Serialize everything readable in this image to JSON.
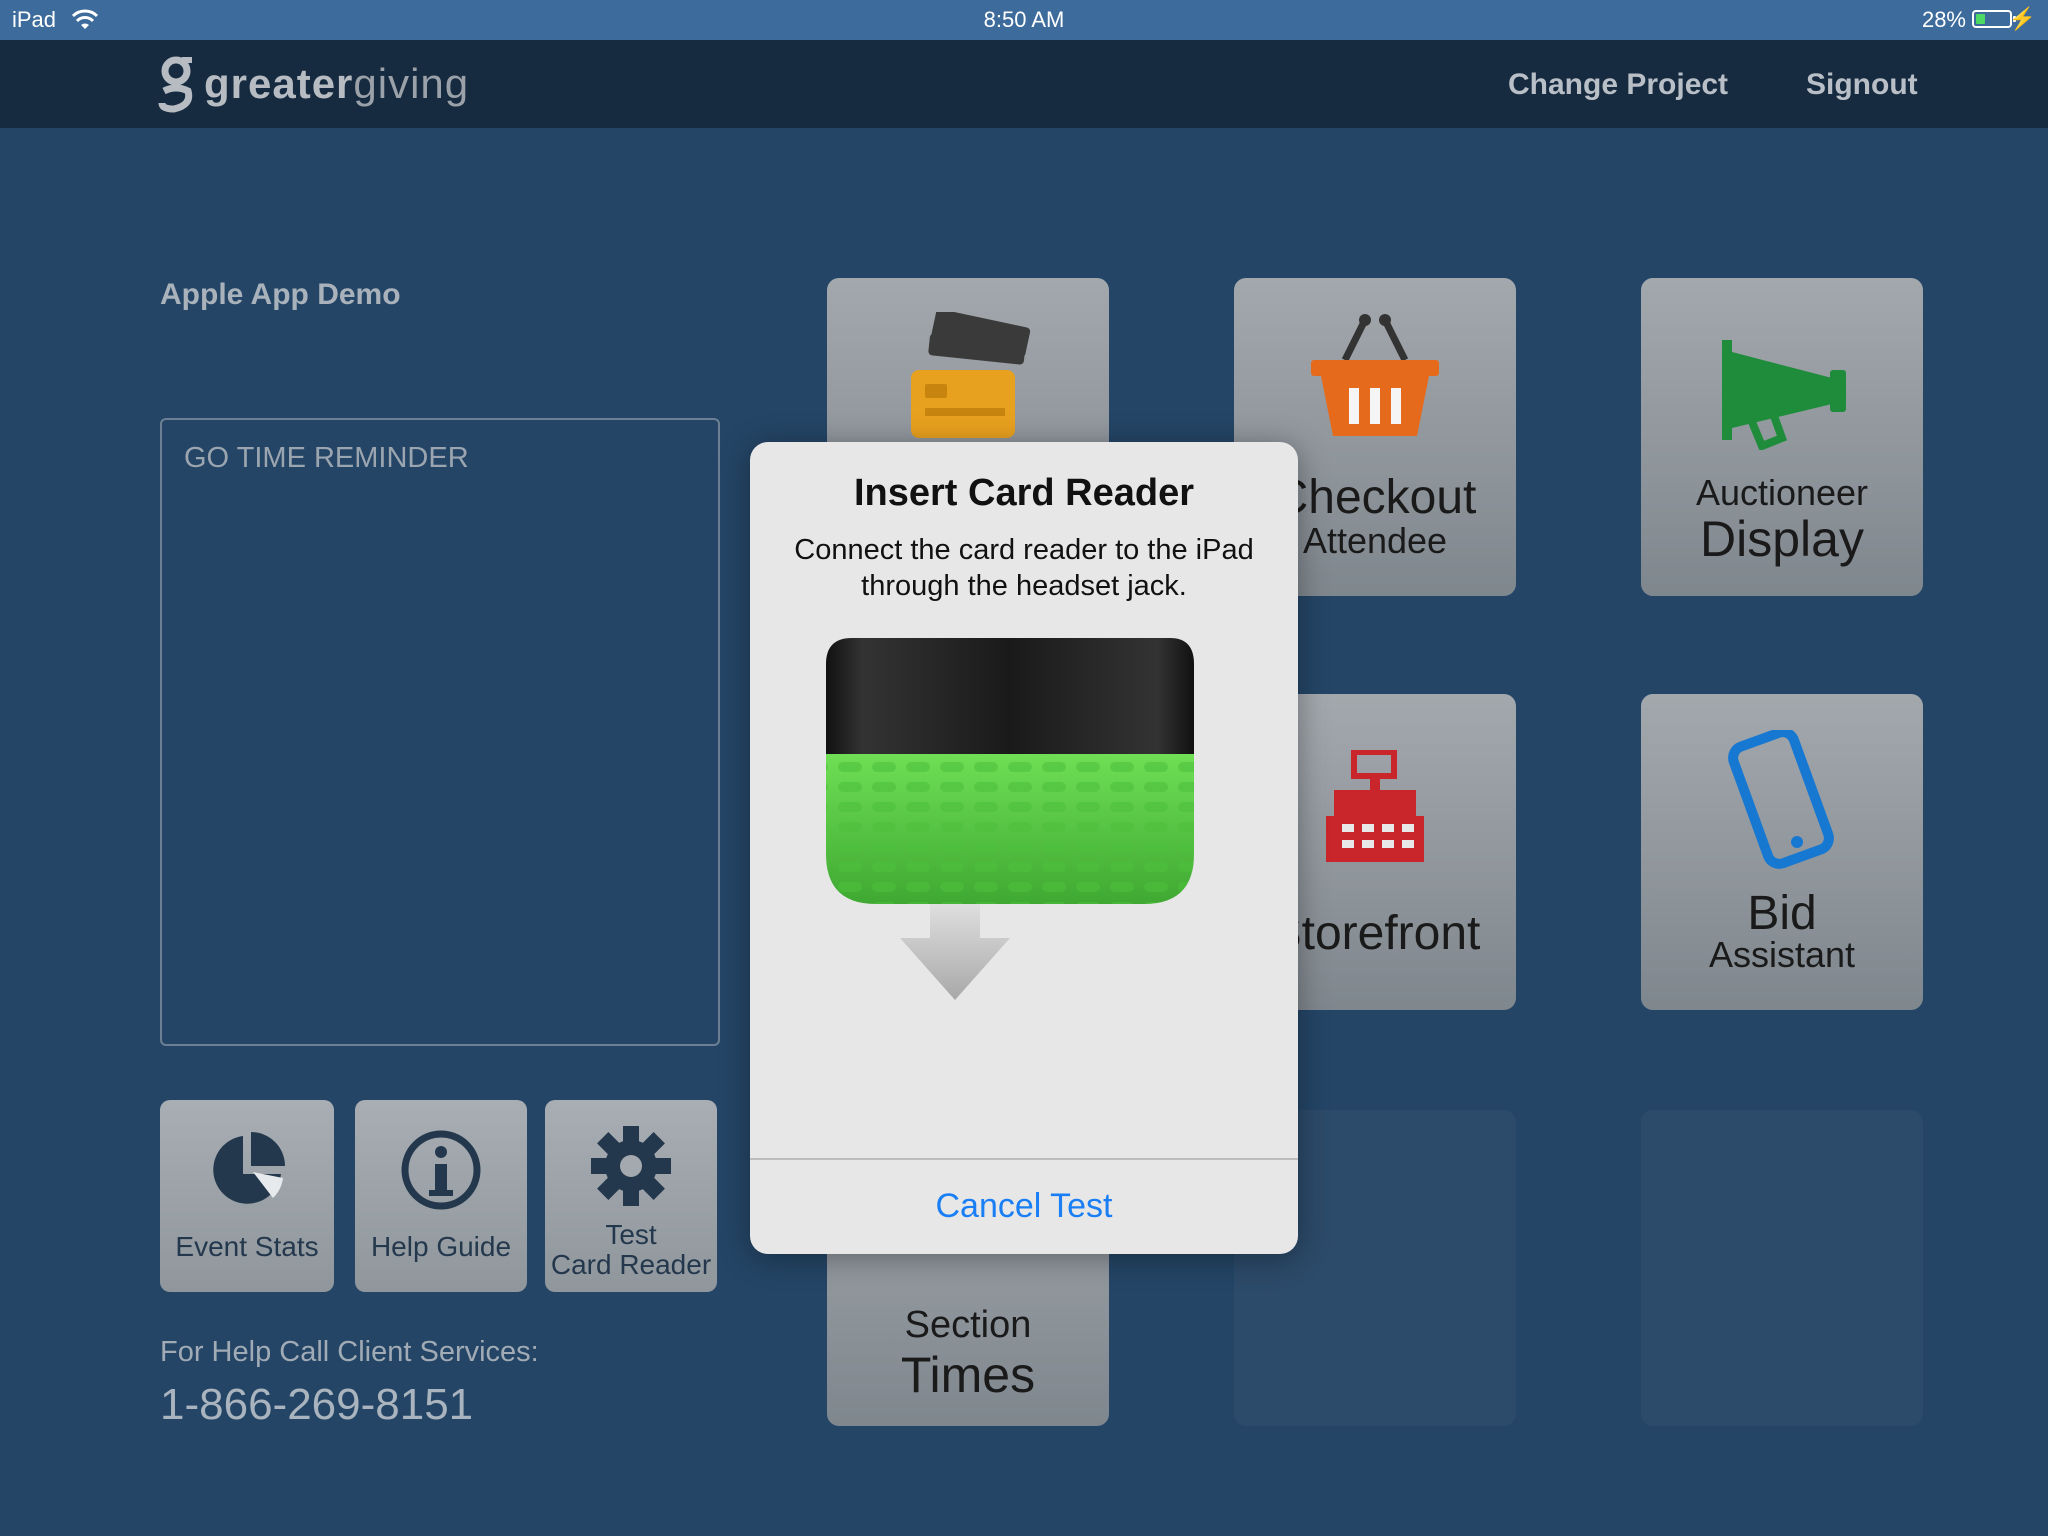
{
  "status_bar": {
    "device": "iPad",
    "time": "8:50 AM",
    "battery": "28%",
    "battery_level": 0.28
  },
  "header": {
    "logo_part1": "greater",
    "logo_part2": "giving",
    "change_project": "Change Project",
    "signout": "Signout"
  },
  "project": {
    "title": "Apple App Demo"
  },
  "reminder": {
    "label": "GO TIME REMINDER"
  },
  "small_tiles": [
    {
      "label": "Event Stats",
      "icon": "pie-chart-icon"
    },
    {
      "label": "Help Guide",
      "icon": "info-icon"
    },
    {
      "line1": "Test",
      "line2": "Card Reader",
      "icon": "gear-icon"
    }
  ],
  "help": {
    "text": "For Help Call Client Services:",
    "phone": "1-866-269-8151"
  },
  "tiles": {
    "checkout": {
      "line1": "Checkout",
      "line2": "Attendee",
      "icon": "basket-icon"
    },
    "auctioneer": {
      "line1": "Auctioneer",
      "line2": "Display",
      "icon": "megaphone-icon"
    },
    "storefront": {
      "line1": "Storefront",
      "icon": "cash-register-icon"
    },
    "bid": {
      "line1": "Bid",
      "line2": "Assistant",
      "icon": "phone-icon"
    },
    "section": {
      "line1": "Section",
      "line2": "Times",
      "icon": "clock-icon"
    },
    "card": {
      "icon": "credit-card-icon"
    }
  },
  "modal": {
    "title": "Insert Card Reader",
    "message_line1": "Connect the card reader to the iPad",
    "message_line2": "through the headset jack.",
    "cancel": "Cancel Test"
  },
  "colors": {
    "background": "#244566",
    "header": "#162a40",
    "status_bar": "#3d6b9c",
    "link_blue": "#1a7ff5",
    "reader_green": "#5fd04a"
  }
}
